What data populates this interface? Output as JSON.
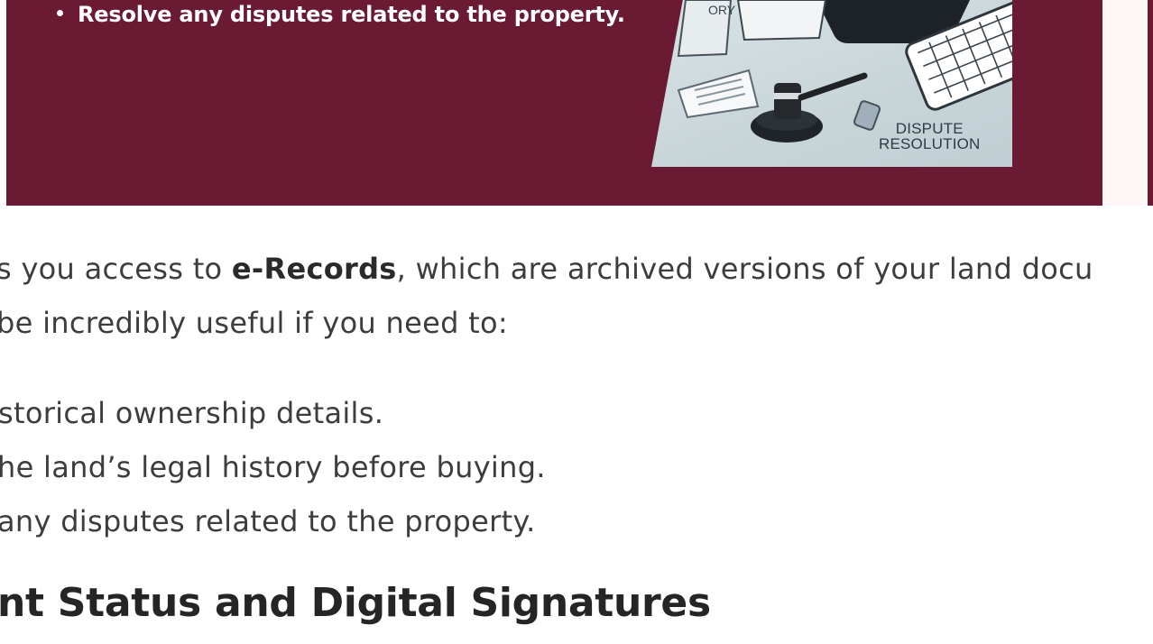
{
  "banner": {
    "bullet_text": "Resolve any disputes related to the property.",
    "image_label_line1": "DISPUTE",
    "image_label_line2": "RESOLUTION",
    "image_corner_text": "ORY",
    "background_color": "#6a1a33"
  },
  "article": {
    "paragraph": {
      "line1_before": "s you access to ",
      "line1_bold": "e-Records",
      "line1_after": ", which are archived versions of your land docu",
      "line2": " be incredibly useful if you need to:"
    },
    "list_items": [
      "storical ownership details.",
      "he land’s legal history before buying.",
      "any disputes related to the property."
    ],
    "heading": "nt Status and Digital Signatures"
  }
}
